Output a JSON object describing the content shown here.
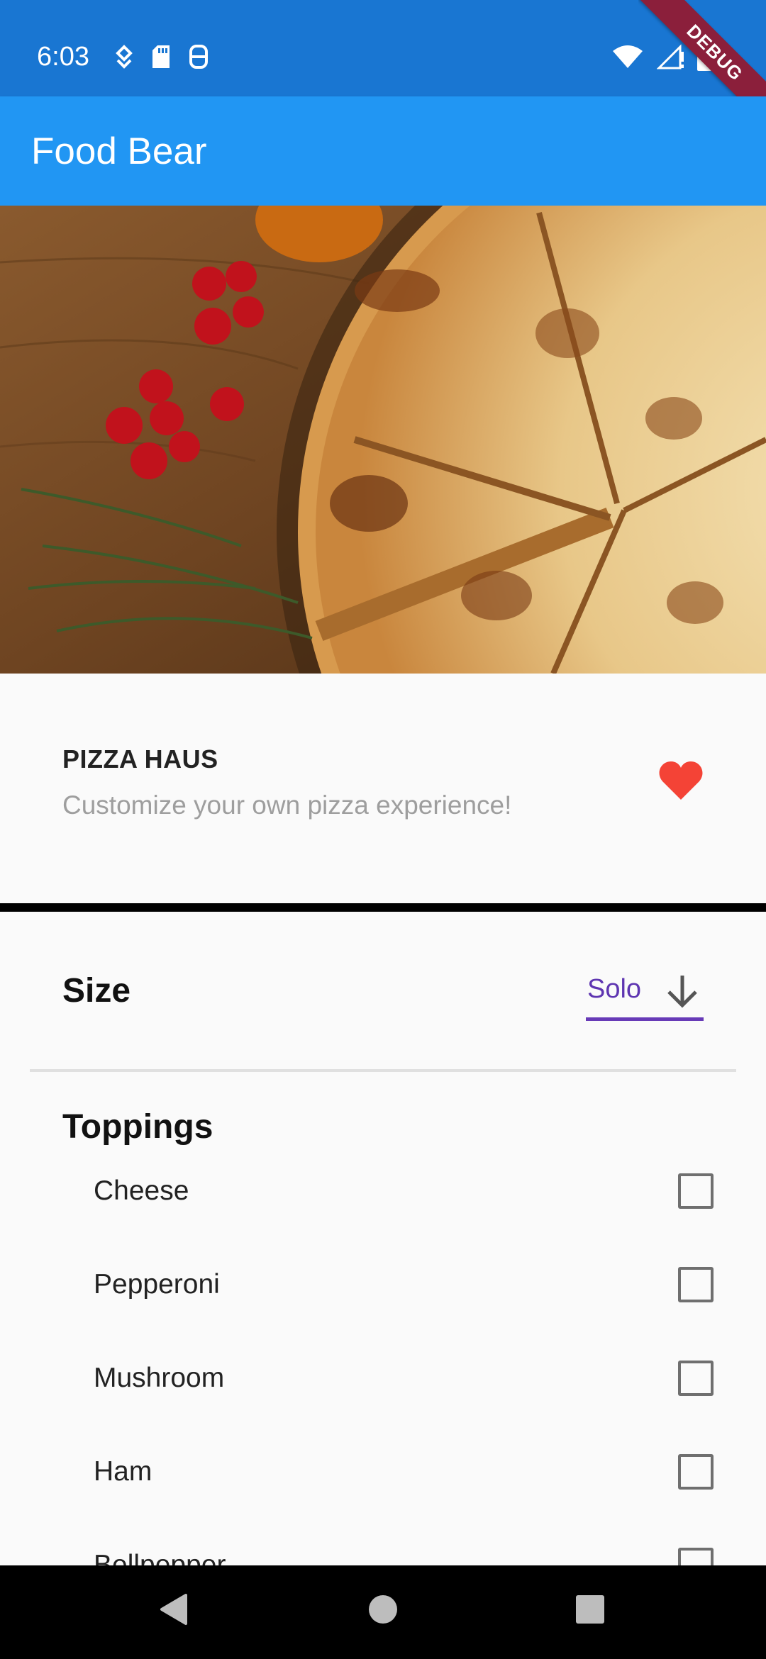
{
  "status_bar": {
    "time": "6:03",
    "icons_left": [
      "location-icon",
      "sd-card-icon",
      "app-notification-icon"
    ],
    "icons_right": [
      "wifi-icon",
      "signal-icon",
      "battery-icon"
    ]
  },
  "debug_banner": "DEBUG",
  "app_bar": {
    "title": "Food Bear"
  },
  "hero": {
    "image": "pizza-photo"
  },
  "restaurant": {
    "name": "PIZZA HAUS",
    "tagline": "Customize your own pizza experience!",
    "favorite": true
  },
  "size": {
    "label": "Size",
    "selected": "Solo"
  },
  "toppings": {
    "label": "Toppings",
    "items": [
      {
        "name": "Cheese",
        "checked": false
      },
      {
        "name": "Pepperoni",
        "checked": false
      },
      {
        "name": "Mushroom",
        "checked": false
      },
      {
        "name": "Ham",
        "checked": false
      },
      {
        "name": "Bellpepper",
        "checked": false
      }
    ]
  },
  "colors": {
    "status_bar": "#1976d2",
    "app_bar": "#2196f3",
    "accent": "#673ab7",
    "favorite": "#f44336"
  },
  "nav_bar": {
    "buttons": [
      "back-icon",
      "home-icon",
      "recents-icon"
    ]
  }
}
